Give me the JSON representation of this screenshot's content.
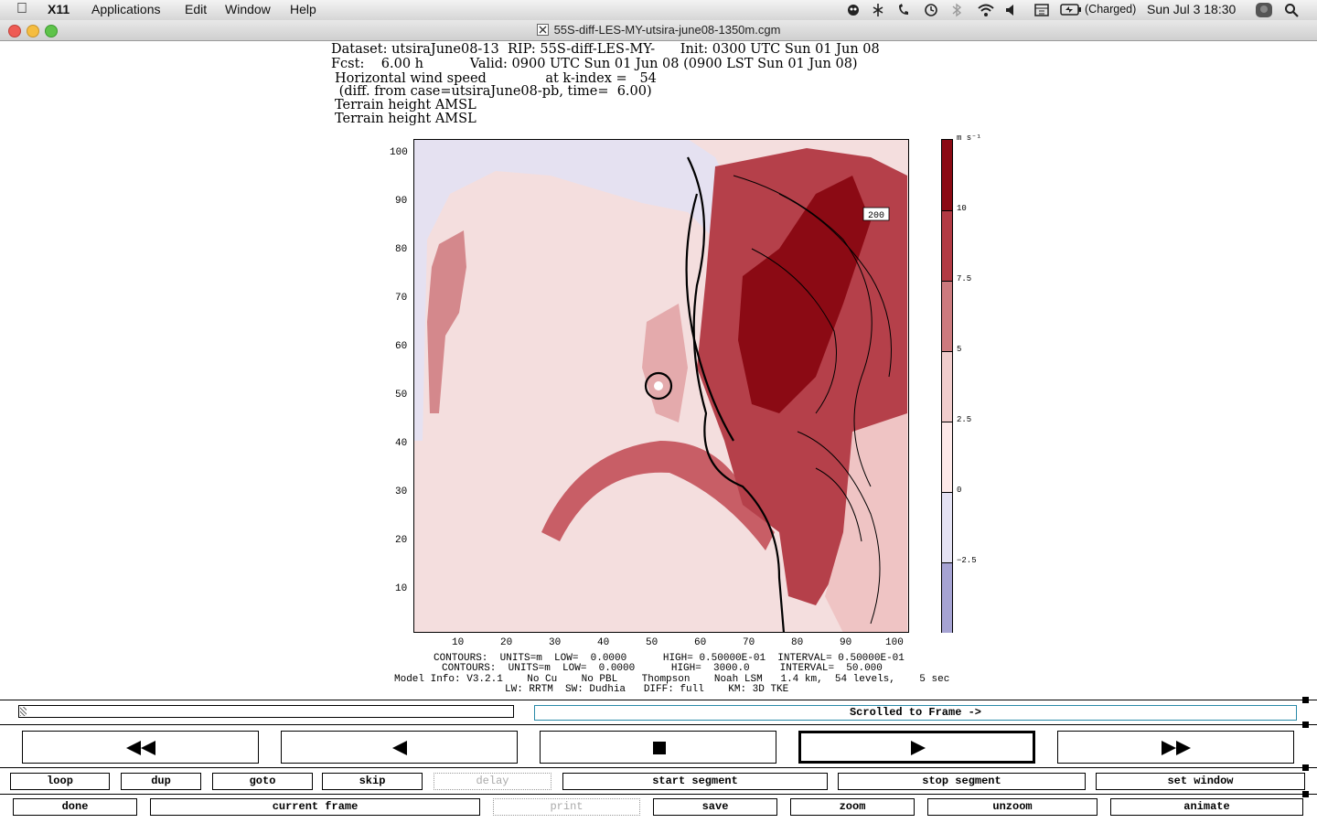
{
  "menubar": {
    "app": "X11",
    "menus": [
      "Applications",
      "Edit",
      "Window",
      "Help"
    ],
    "battery": "(Charged)",
    "clock": "Sun Jul 3  18:30"
  },
  "window": {
    "title": "55S-diff-LES-MY-utsira-june08-1350m.cgm"
  },
  "plot_header": {
    "line1": "Dataset: utsiraJune08-13  RIP: 55S-diff-LES-MY-      Init: 0300 UTC Sun 01 Jun 08",
    "line2": "Fcst:    6.00 h           Valid: 0900 UTC Sun 01 Jun 08 (0900 LST Sun 01 Jun 08)",
    "line3": "Horizontal wind speed              at k-index =   54",
    "line4": " (diff. from case=utsiraJune08-pb, time=  6.00)",
    "line5": "Terrain height AMSL",
    "line6": "Terrain height AMSL"
  },
  "plot": {
    "y_ticks": [
      "100",
      "90",
      "80",
      "70",
      "60",
      "50",
      "40",
      "30",
      "20",
      "10"
    ],
    "x_ticks": [
      "10",
      "20",
      "30",
      "40",
      "50",
      "60",
      "70",
      "80",
      "90",
      "100"
    ],
    "contour_label": "200",
    "colorbar_unit": "m s⁻¹",
    "colorbar_ticks": [
      "10",
      "7.5",
      "5",
      "2.5",
      "0",
      "−2.5"
    ],
    "colorbar_colors": [
      "#8b0a14",
      "#b23a44",
      "#cc7a7e",
      "#f0cccc",
      "#fde9e9",
      "#e4e2f3",
      "#a6a3d3"
    ]
  },
  "footer": {
    "line1": "CONTOURS:  UNITS=m  LOW=  0.0000      HIGH= 0.50000E-01  INTERVAL= 0.50000E-01",
    "line2": "CONTOURS:  UNITS=m  LOW=  0.0000      HIGH=  3000.0     INTERVAL=  50.000",
    "line3": "Model Info: V3.2.1    No Cu    No PBL    Thompson    Noah LSM   1.4 km,  54 levels,    5 sec",
    "line4": "LW: RRTM  SW: Dudhia   DIFF: full    KM: 3D TKE"
  },
  "status": {
    "text": "Scrolled to Frame ->"
  },
  "nav": {
    "rewind_icon": "fast-rewind-icon",
    "back_icon": "step-back-icon",
    "stop_icon": "stop-icon",
    "play_icon": "play-icon",
    "forward_icon": "fast-forward-icon"
  },
  "buttons_row1": [
    "loop",
    "dup",
    "goto",
    "skip",
    "delay",
    "start segment",
    "stop segment",
    "set window"
  ],
  "buttons_row2": [
    "done",
    "current frame",
    "print",
    "save",
    "zoom",
    "unzoom",
    "animate"
  ]
}
